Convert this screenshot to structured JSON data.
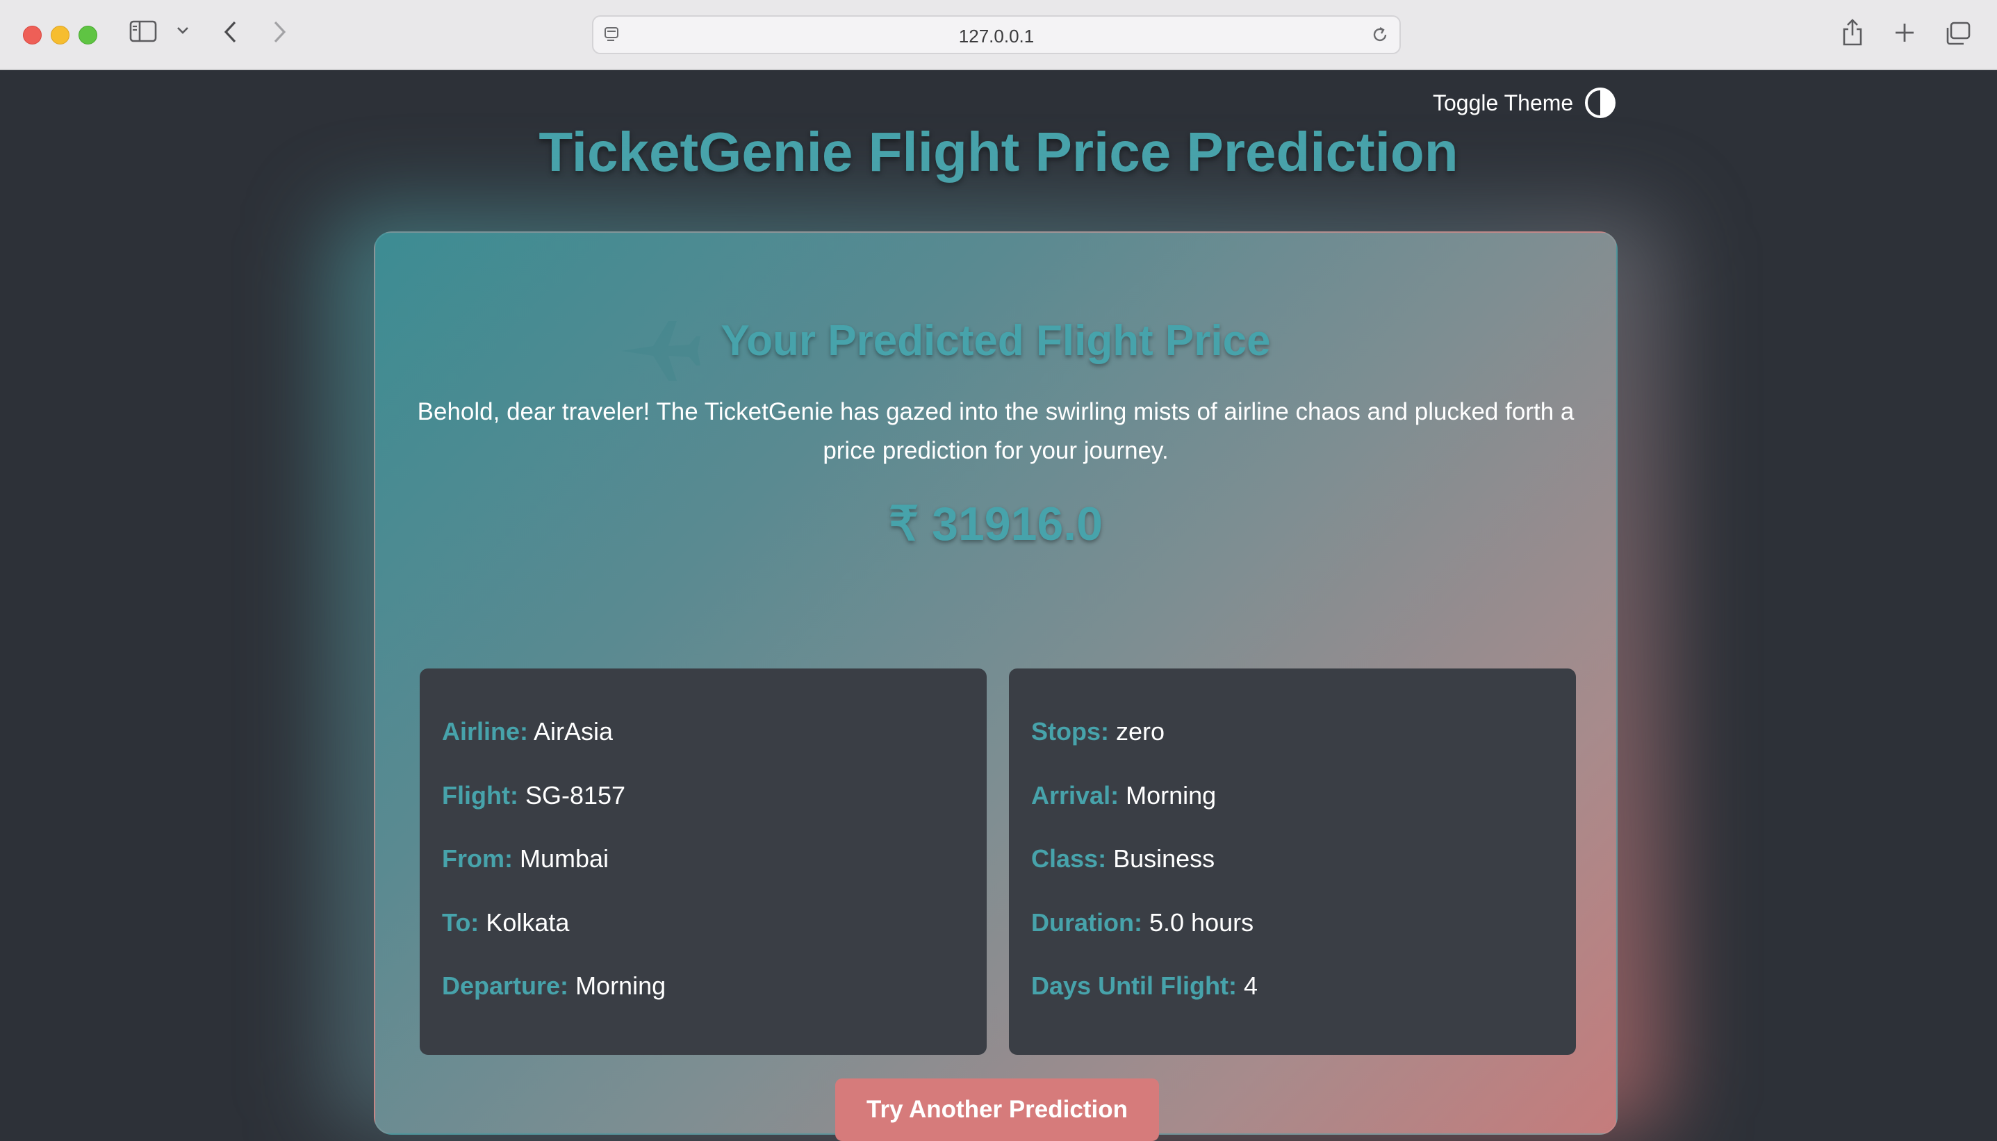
{
  "browser": {
    "url": "127.0.0.1",
    "icons": [
      "sidebar-icon",
      "chevron-down-icon",
      "back-icon",
      "forward-icon",
      "page-menu-icon",
      "reload-icon",
      "share-icon",
      "new-tab-icon",
      "tab-overview-icon"
    ]
  },
  "header": {
    "toggle_label": "Toggle Theme",
    "title": "TicketGenie Flight Price Prediction"
  },
  "result": {
    "title": "Your Predicted Flight Price",
    "description": "Behold, dear traveler! The TicketGenie has gazed into the swirling mists of airline chaos and plucked forth a price prediction for your journey.",
    "price": "₹ 31916.0"
  },
  "details_left": [
    {
      "key": "Airline:",
      "value": "AirAsia"
    },
    {
      "key": "Flight:",
      "value": "SG-8157"
    },
    {
      "key": "From:",
      "value": "Mumbai"
    },
    {
      "key": "To:",
      "value": "Kolkata"
    },
    {
      "key": "Departure:",
      "value": "Morning"
    }
  ],
  "details_right": [
    {
      "key": "Stops:",
      "value": "zero"
    },
    {
      "key": "Arrival:",
      "value": "Morning"
    },
    {
      "key": "Class:",
      "value": "Business"
    },
    {
      "key": "Duration:",
      "value": "5.0 hours"
    },
    {
      "key": "Days Until Flight:",
      "value": "4"
    }
  ],
  "actions": {
    "try_again_label": "Try Another Prediction"
  },
  "colors": {
    "accent": "#47a3ab",
    "button": "#d67b7b",
    "background": "#2d3138",
    "detail_box": "#3a3e45"
  }
}
